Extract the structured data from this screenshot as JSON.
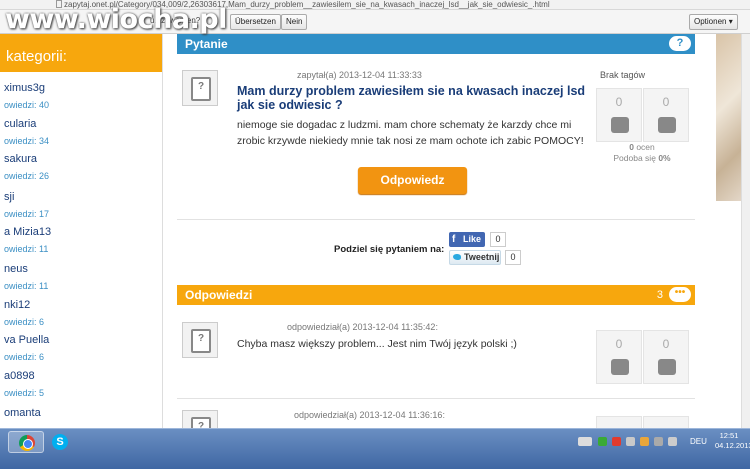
{
  "browser": {
    "address": "zapytaj.onet.pl/Category/034,009/2,26303617,Mam_durzy_problem__zawiesilem_sie_na_kwasach_inaczej_lsd__jak_sie_odwiesic_.html",
    "translate_question": "u...zt werden?",
    "translate_button": "Übersetzen",
    "no_button": "Nein",
    "options_button": "Optionen ▾"
  },
  "watermark": "www.wiocha.pl",
  "sidebar": {
    "title": "kategorii:",
    "users": [
      {
        "name": "ximus3g",
        "count": "owiedzi: 40"
      },
      {
        "name": "cularia",
        "count": "owiedzi: 34"
      },
      {
        "name": "sakura",
        "count": "owiedzi: 26"
      },
      {
        "name": "sji",
        "count": "owiedzi: 17"
      },
      {
        "name": "a Mizia13",
        "count": "owiedzi: 11"
      },
      {
        "name": "neus",
        "count": "owiedzi: 11"
      },
      {
        "name": "nki12",
        "count": "owiedzi: 6"
      },
      {
        "name": "va Puella",
        "count": "owiedzi: 6"
      },
      {
        "name": "a0898",
        "count": "owiedzi: 5"
      },
      {
        "name": "omanta",
        "count": ""
      }
    ]
  },
  "question": {
    "section_title": "Pytanie",
    "meta": "zapytał(a) 2013-12-04 11:33:33",
    "title": "Mam durzy problem zawiesiłem sie na kwasach inaczej lsd jak sie odwiesic ?",
    "body": "niemoge sie dogadac z ludzmi. mam chore schematy że karzdy chce mi zrobic krzywde niekiedy mnie tak nosi ze mam ochote ich zabic POMOCY!",
    "answer_button": "Odpowiedz",
    "tags": "Brak tagów",
    "votes_up": "0",
    "votes_down": "0",
    "ratings_count": "0",
    "ratings_label": "ocen",
    "likes_label": "Podoba się",
    "likes_value": "0%"
  },
  "share": {
    "label": "Podziel się pytaniem na:",
    "like": "Like",
    "like_count": "0",
    "tweet": "Tweetnij",
    "tweet_count": "0"
  },
  "answers": {
    "section_title": "Odpowiedzi",
    "count": "3",
    "items": [
      {
        "meta": "odpowiedział(a) 2013-12-04 11:35:42:",
        "text": "Chyba masz większy problem... Jest nim Twój język polski ;)",
        "up": "0",
        "down": "0"
      },
      {
        "meta": "odpowiedział(a) 2013-12-04 11:36:16:",
        "text": "",
        "up": "",
        "down": ""
      }
    ]
  },
  "taskbar": {
    "lang": "DEU",
    "time": "12:51",
    "date": "04.12.2013"
  }
}
